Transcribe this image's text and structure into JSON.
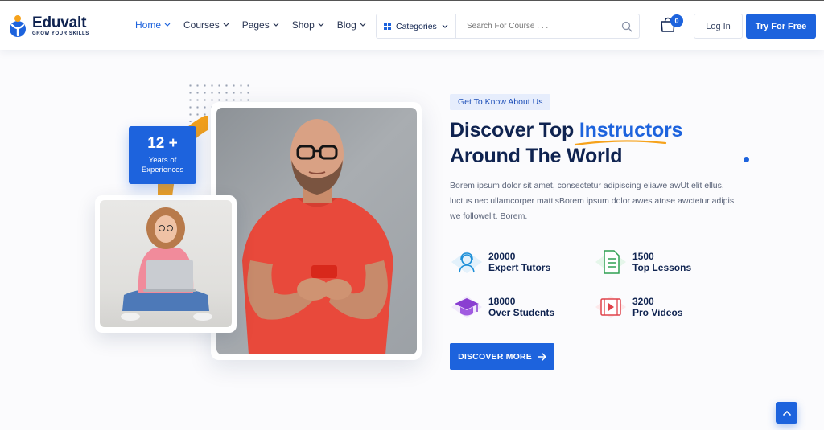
{
  "brand": {
    "name": "Eduvalt",
    "tagline": "GROW YOUR SKILLS",
    "accent": "#1d63dd",
    "navy": "#0f2350",
    "orange": "#f6a21b"
  },
  "nav": {
    "items": [
      {
        "label": "Home",
        "active": true
      },
      {
        "label": "Courses",
        "active": false
      },
      {
        "label": "Pages",
        "active": false
      },
      {
        "label": "Shop",
        "active": false
      },
      {
        "label": "Blog",
        "active": false
      }
    ],
    "categories_label": "Categories",
    "search_placeholder": "Search For Course . . .",
    "cart_count": "0",
    "login_label": "Log In",
    "try_label": "Try For Free"
  },
  "hero": {
    "badge": {
      "number": "12 +",
      "text_line1": "Years of",
      "text_line2": "Experiences"
    },
    "tag": "Get To Know About Us",
    "title_part1": "Discover Top ",
    "title_highlight": "Instructors",
    "title_line2": "Around The World",
    "description": "Borem ipsum dolor sit amet, consectetur adipiscing eliawe awUt elit ellus, luctus nec ullamcorper mattisBorem ipsum dolor awes atnse awctetur adipis we followelit. Borem.",
    "stats": [
      {
        "number": "20000",
        "label": "Expert Tutors",
        "icon": "tutor-headset-icon"
      },
      {
        "number": "1500",
        "label": "Top Lessons",
        "icon": "document-icon"
      },
      {
        "number": "18000",
        "label": "Over Students",
        "icon": "graduation-cap-icon"
      },
      {
        "number": "3200",
        "label": "Pro Videos",
        "icon": "video-film-icon"
      }
    ],
    "cta_label": "DISCOVER MORE"
  }
}
